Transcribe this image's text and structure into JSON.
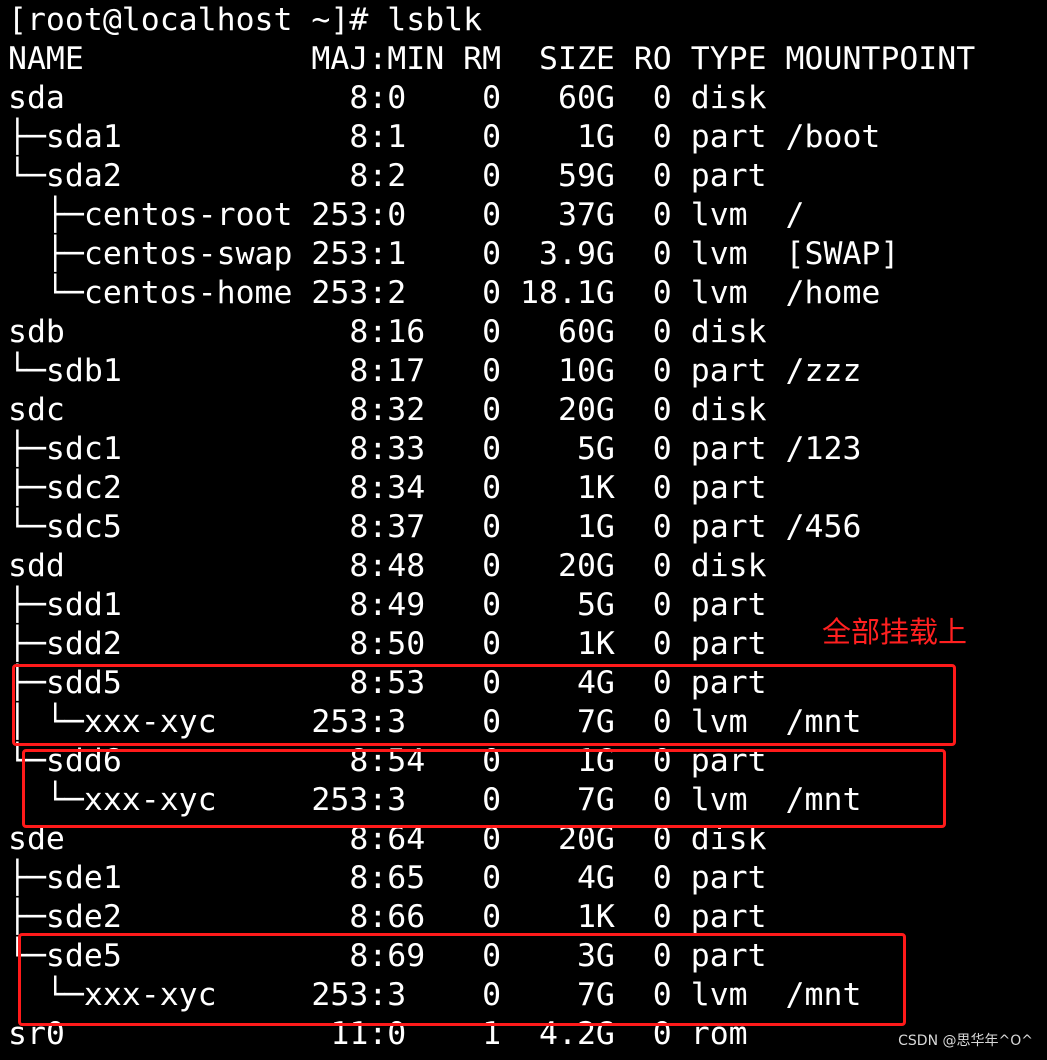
{
  "terminal": {
    "prompt_line": "[root@localhost ~]# lsblk",
    "header_line": "NAME            MAJ:MIN RM  SIZE RO TYPE MOUNTPOINT",
    "rows": [
      "sda               8:0    0   60G  0 disk",
      "├─sda1            8:1    0    1G  0 part /boot",
      "└─sda2            8:2    0   59G  0 part",
      "  ├─centos-root 253:0    0   37G  0 lvm  /",
      "  ├─centos-swap 253:1    0  3.9G  0 lvm  [SWAP]",
      "  └─centos-home 253:2    0 18.1G  0 lvm  /home",
      "sdb               8:16   0   60G  0 disk",
      "└─sdb1            8:17   0   10G  0 part /zzz",
      "sdc               8:32   0   20G  0 disk",
      "├─sdc1            8:33   0    5G  0 part /123",
      "├─sdc2            8:34   0    1K  0 part",
      "└─sdc5            8:37   0    1G  0 part /456",
      "sdd               8:48   0   20G  0 disk",
      "├─sdd1            8:49   0    5G  0 part",
      "├─sdd2            8:50   0    1K  0 part",
      "├─sdd5            8:53   0    4G  0 part",
      "│ └─xxx-xyc     253:3    0    7G  0 lvm  /mnt",
      "└─sdd6            8:54   0    1G  0 part",
      "  └─xxx-xyc     253:3    0    7G  0 lvm  /mnt",
      "sde               8:64   0   20G  0 disk",
      "├─sde1            8:65   0    4G  0 part",
      "├─sde2            8:66   0    1K  0 part",
      "└─sde5            8:69   0    3G  0 part",
      "  └─xxx-xyc     253:3    0    7G  0 lvm  /mnt",
      "sr0              11:0    1  4.2G  0 rom"
    ]
  },
  "annotation": {
    "label": "全部挂载上",
    "color": "#ff1a1a"
  },
  "watermark": "CSDN @思华年^O^"
}
